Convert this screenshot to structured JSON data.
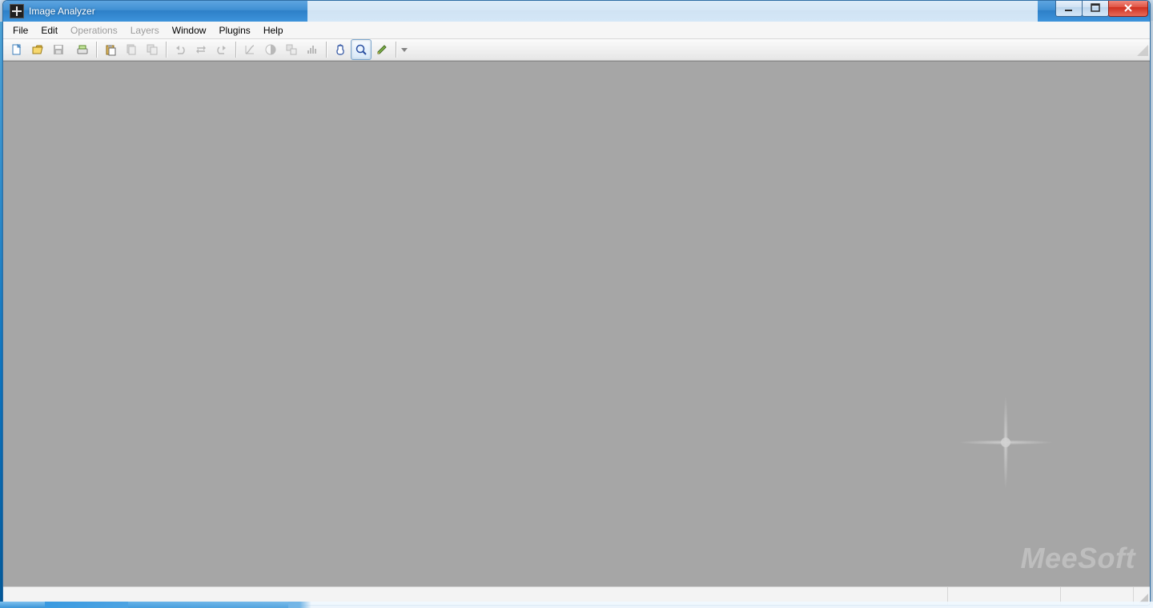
{
  "window": {
    "title": "Image Analyzer"
  },
  "menu": {
    "items": [
      {
        "label": "File",
        "enabled": true
      },
      {
        "label": "Edit",
        "enabled": true
      },
      {
        "label": "Operations",
        "enabled": false
      },
      {
        "label": "Layers",
        "enabled": false
      },
      {
        "label": "Window",
        "enabled": true
      },
      {
        "label": "Plugins",
        "enabled": true
      },
      {
        "label": "Help",
        "enabled": true
      }
    ]
  },
  "toolbar": {
    "groups": [
      [
        {
          "id": "new",
          "name": "new-file-icon",
          "enabled": true
        },
        {
          "id": "open",
          "name": "open-file-icon",
          "enabled": true
        },
        {
          "id": "save",
          "name": "save-icon",
          "enabled": false
        },
        {
          "id": "scan",
          "name": "scanner-icon",
          "enabled": true
        }
      ],
      [
        {
          "id": "paste",
          "name": "paste-icon",
          "enabled": true
        },
        {
          "id": "copy",
          "name": "copy-icon",
          "enabled": false
        },
        {
          "id": "copy2",
          "name": "duplicate-icon",
          "enabled": false
        }
      ],
      [
        {
          "id": "undo",
          "name": "undo-icon",
          "enabled": false
        },
        {
          "id": "swap",
          "name": "swap-icon",
          "enabled": false
        },
        {
          "id": "redo",
          "name": "redo-icon",
          "enabled": false
        }
      ],
      [
        {
          "id": "curves",
          "name": "curves-icon",
          "enabled": false
        },
        {
          "id": "contrast",
          "name": "contrast-icon",
          "enabled": false
        },
        {
          "id": "resize",
          "name": "resize-icon",
          "enabled": false
        },
        {
          "id": "levels",
          "name": "levels-icon",
          "enabled": false
        }
      ],
      [
        {
          "id": "hand",
          "name": "hand-tool-icon",
          "enabled": true,
          "active": false
        },
        {
          "id": "zoom",
          "name": "zoom-tool-icon",
          "enabled": true,
          "active": true
        },
        {
          "id": "pencil",
          "name": "pencil-tool-icon",
          "enabled": true,
          "active": false
        }
      ]
    ],
    "dropdown": {
      "name": "toolbar-overflow-icon"
    }
  },
  "workspace": {
    "watermark": "MeeSoft"
  },
  "statusbar": {
    "main": "",
    "cell1": "",
    "cell2": ""
  }
}
